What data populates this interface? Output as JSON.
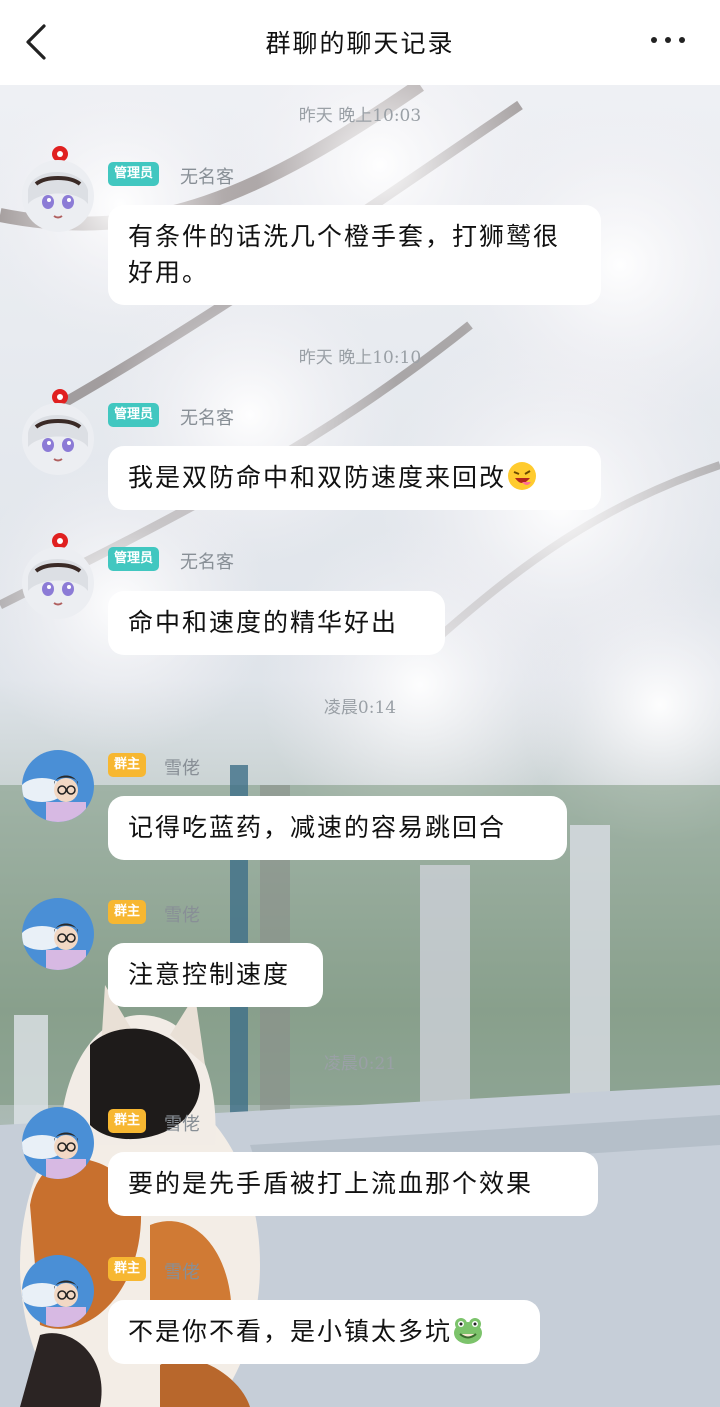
{
  "header": {
    "title": "群聊的聊天记录"
  },
  "messages": [
    {
      "time": "昨天 晚上10:03",
      "role": "管理员",
      "sender": "无名客",
      "text": "有条件的话洗几个橙手套，打狮鹫很好用。"
    },
    {
      "time": "昨天 晚上10:10",
      "role": "管理员",
      "sender": "无名客",
      "text": "我是双防命中和双防速度来回改",
      "emoji": "laughing-face-emoji"
    },
    {
      "role": "管理员",
      "sender": "无名客",
      "text": "命中和速度的精华好出"
    },
    {
      "time": "凌晨0:14",
      "role": "群主",
      "sender": "雪佬",
      "text": "记得吃蓝药，减速的容易跳回合"
    },
    {
      "role": "群主",
      "sender": "雪佬",
      "text": "注意控制速度"
    },
    {
      "time": "凌晨0:21",
      "role": "群主",
      "sender": "雪佬",
      "text": "要的是先手盾被打上流血那个效果"
    },
    {
      "role": "群主",
      "sender": "雪佬",
      "text": "不是你不看，是小镇太多坑",
      "emoji": "frog-emoji"
    }
  ],
  "icons": {
    "back": "chevron-left-icon",
    "more": "more-dots-icon"
  },
  "colors": {
    "admin_badge": "#41c7c0",
    "owner_badge": "#f7b731",
    "bubble": "#ffffff"
  }
}
